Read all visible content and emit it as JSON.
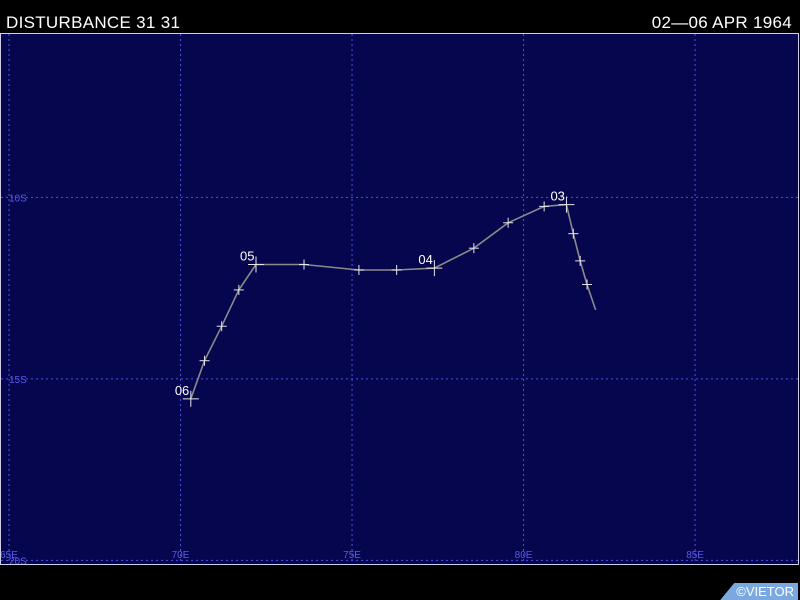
{
  "header": {
    "title": "DISTURBANCE 31 31",
    "dates": "02—06 APR 1964"
  },
  "credit": "©VIETOR",
  "colors": {
    "ocean": "#06064e",
    "grid": "#5050e0",
    "grid_label": "#5a5af0",
    "track": "#8a8a8a",
    "marker": "#e6e6e6",
    "label": "#ffffff"
  },
  "map": {
    "lon_range": [
      65,
      88
    ],
    "lat_range": [
      -20.1,
      -5.5
    ],
    "lon_ticks": [
      {
        "value": 65,
        "label": "65E"
      },
      {
        "value": 70,
        "label": "70E"
      },
      {
        "value": 75,
        "label": "75E"
      },
      {
        "value": 80,
        "label": "80E"
      },
      {
        "value": 85,
        "label": "85E"
      }
    ],
    "lat_ticks": [
      {
        "value": -10,
        "label": "10S"
      },
      {
        "value": -15,
        "label": "15S"
      },
      {
        "value": -20,
        "label": "20S"
      }
    ]
  },
  "track": {
    "points": [
      {
        "lon": 82.1,
        "lat": -13.1,
        "tick": false
      },
      {
        "lon": 81.85,
        "lat": -12.4,
        "tick": true
      },
      {
        "lon": 81.65,
        "lat": -11.75,
        "tick": true
      },
      {
        "lon": 81.45,
        "lat": -11.0,
        "tick": true
      },
      {
        "lon": 81.25,
        "lat": -10.2,
        "tick": true,
        "label": "03",
        "major": true
      },
      {
        "lon": 80.6,
        "lat": -10.25,
        "tick": true
      },
      {
        "lon": 79.55,
        "lat": -10.7,
        "tick": true
      },
      {
        "lon": 78.55,
        "lat": -11.4,
        "tick": true
      },
      {
        "lon": 77.4,
        "lat": -11.95,
        "tick": true,
        "label": "04",
        "major": true
      },
      {
        "lon": 76.3,
        "lat": -12.0,
        "tick": true
      },
      {
        "lon": 75.2,
        "lat": -12.0,
        "tick": true
      },
      {
        "lon": 73.6,
        "lat": -11.85,
        "tick": true
      },
      {
        "lon": 72.2,
        "lat": -11.85,
        "tick": true,
        "label": "05",
        "major": true
      },
      {
        "lon": 71.7,
        "lat": -12.55,
        "tick": true
      },
      {
        "lon": 71.2,
        "lat": -13.55,
        "tick": true
      },
      {
        "lon": 70.7,
        "lat": -14.5,
        "tick": true
      },
      {
        "lon": 70.3,
        "lat": -15.55,
        "tick": true,
        "label": "06",
        "major": true
      }
    ]
  }
}
